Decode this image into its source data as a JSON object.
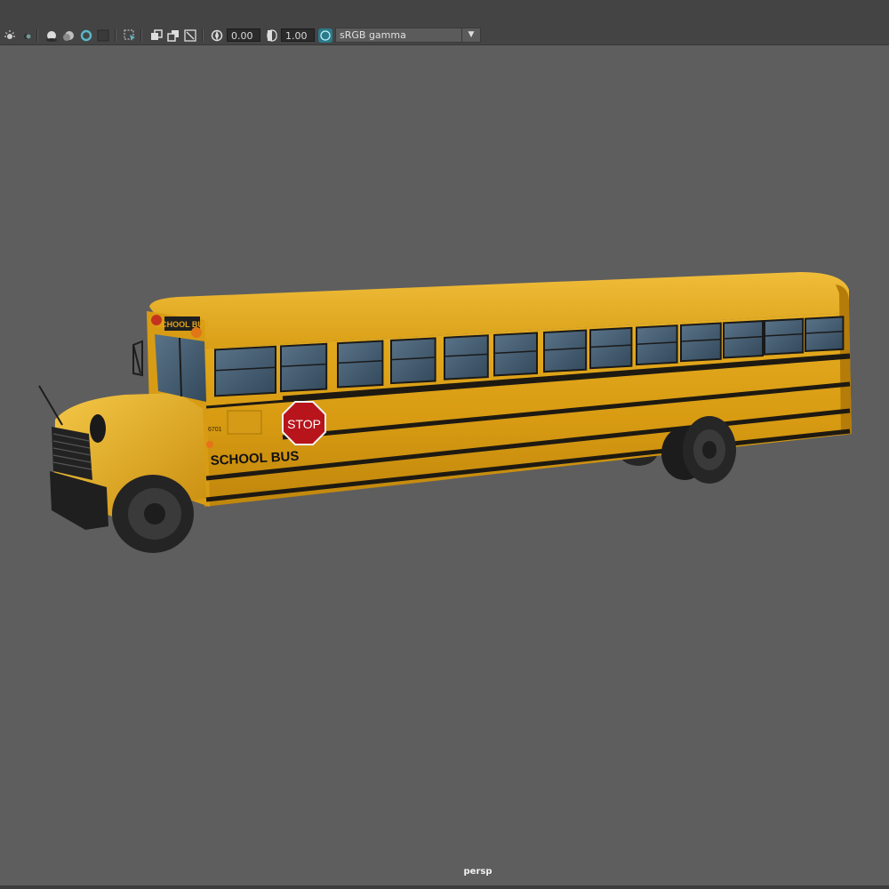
{
  "toolbar": {
    "exposure_value": "0.00",
    "gamma_value": "1.00",
    "color_space": "sRGB gamma",
    "icons": [
      "light-icon",
      "shadow-icon",
      "ambient-occlusion-icon",
      "motion-blur-icon",
      "antialias-icon",
      "texture-icon",
      "isolate-select-icon",
      "xray-icon",
      "wireframe-icon",
      "bounding-box-icon",
      "exposure-icon",
      "gamma-icon",
      "color-management-icon"
    ]
  },
  "viewport": {
    "camera": "persp",
    "background": "#5e5e5e"
  },
  "model": {
    "fleet_number": "6701",
    "side_text": "SCHOOL BUS",
    "header_text": "SCHOOL BUS",
    "stop_sign_text": "STOP",
    "body_color": "#e0a31a",
    "stripe_color": "#1e1a12"
  }
}
